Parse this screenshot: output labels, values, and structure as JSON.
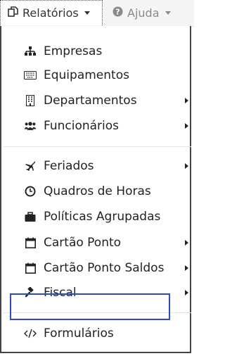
{
  "navbar": {
    "relatorios": {
      "label": "Relatórios",
      "icon": "copy-icon"
    },
    "ajuda": {
      "label": "Ajuda",
      "icon": "question-circle-icon"
    }
  },
  "menu": {
    "items": [
      {
        "label": "Empresas",
        "icon": "sitemap-icon",
        "submenu": false
      },
      {
        "label": "Equipamentos",
        "icon": "keyboard-icon",
        "submenu": false
      },
      {
        "label": "Departamentos",
        "icon": "building-icon",
        "submenu": true
      },
      {
        "label": "Funcionários",
        "icon": "users-icon",
        "submenu": true
      },
      {
        "label": "Feriados",
        "icon": "plane-icon",
        "submenu": true
      },
      {
        "label": "Quadros de Horas",
        "icon": "clock-icon",
        "submenu": false
      },
      {
        "label": "Políticas Agrupadas",
        "icon": "briefcase-icon",
        "submenu": false
      },
      {
        "label": "Cartão Ponto",
        "icon": "calendar-icon",
        "submenu": true
      },
      {
        "label": "Cartão Ponto Saldos",
        "icon": "calendar-icon",
        "submenu": true
      },
      {
        "label": "Fiscal",
        "icon": "gavel-icon",
        "submenu": true
      },
      {
        "label": "Formulários",
        "icon": "code-icon",
        "submenu": false
      }
    ]
  },
  "colors": {
    "highlight_border": "#2b49d8"
  }
}
